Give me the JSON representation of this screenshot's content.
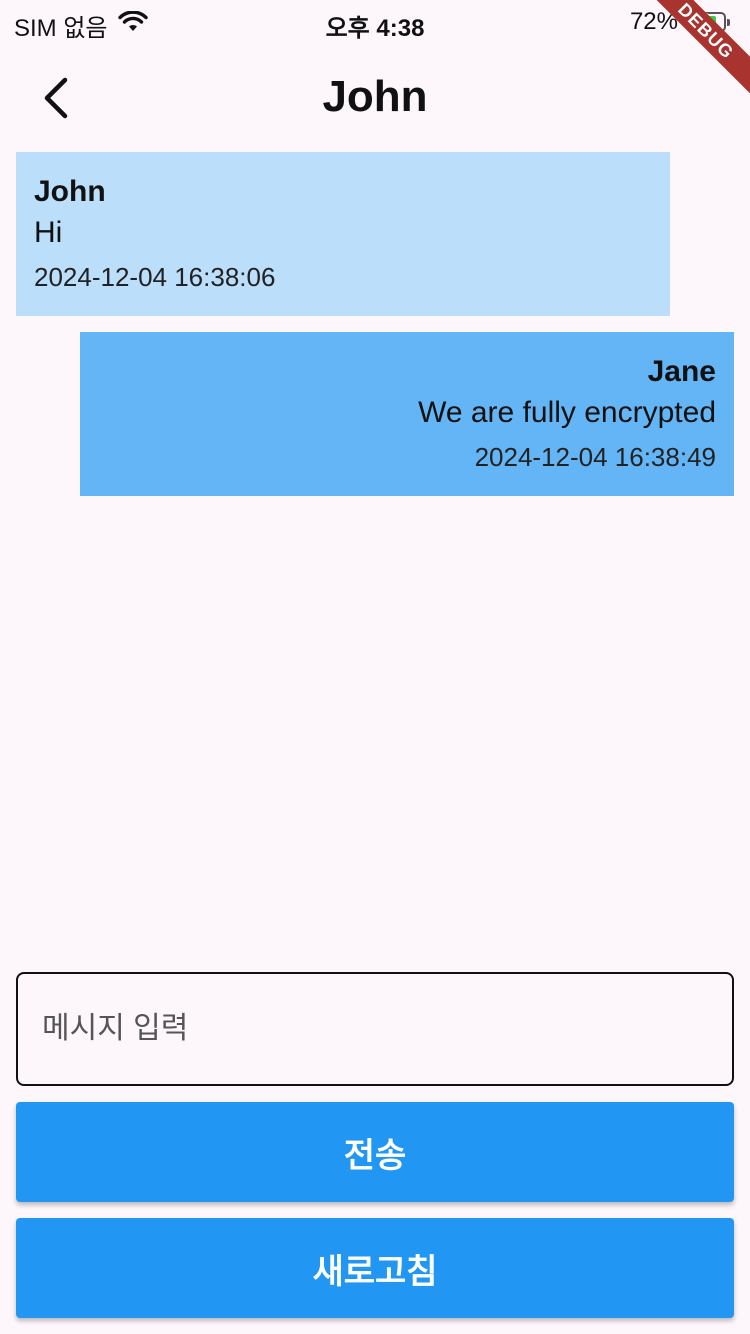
{
  "status_bar": {
    "carrier": "SIM 없음",
    "time": "오후 4:38",
    "battery_percent": "72%",
    "battery_level": 0.72,
    "icons": [
      "wifi-icon",
      "battery-icon",
      "charging-bolt-icon"
    ]
  },
  "debug_banner": "DEBUG",
  "header": {
    "title": "John",
    "back_icon": "chevron-left-icon"
  },
  "messages": [
    {
      "sender": "John",
      "text": "Hi",
      "timestamp": "2024-12-04 16:38:06",
      "align": "left",
      "color": "#bbdefb"
    },
    {
      "sender": "Jane",
      "text": "We are fully encrypted",
      "timestamp": "2024-12-04 16:38:49",
      "align": "right",
      "color": "#64b5f6"
    }
  ],
  "composer": {
    "placeholder": "메시지 입력",
    "value": ""
  },
  "buttons": {
    "send_label": "전송",
    "refresh_label": "새로고침"
  },
  "colors": {
    "background": "#fdf7fc",
    "button": "#2196f3"
  }
}
